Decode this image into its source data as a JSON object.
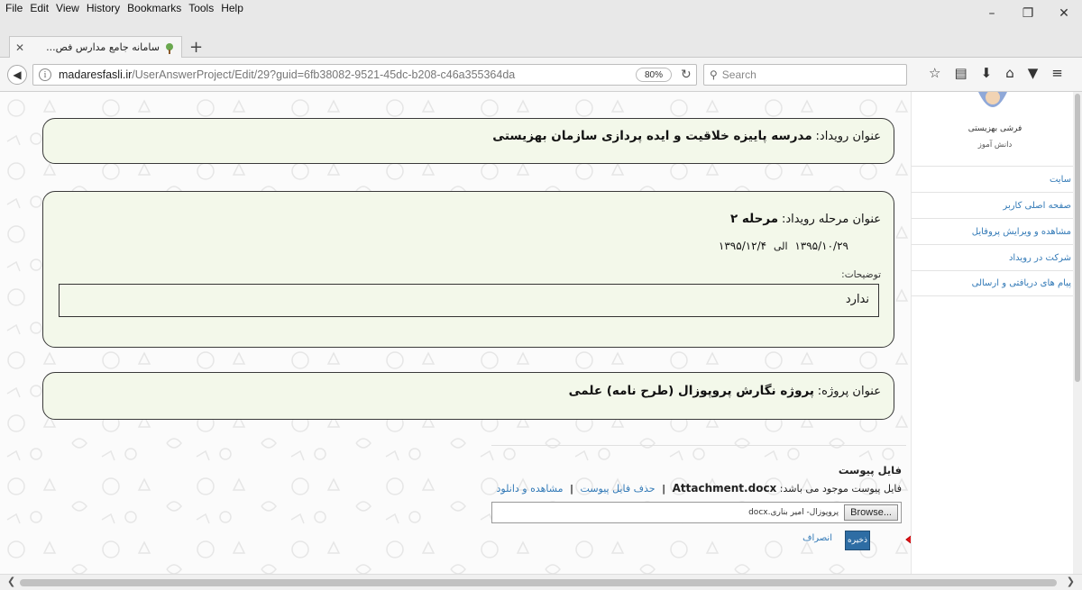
{
  "browser": {
    "menus": [
      "File",
      "Edit",
      "View",
      "History",
      "Bookmarks",
      "Tools",
      "Help"
    ],
    "tab_title": "سامانه جامع مدارس فص...",
    "url_host": "madaresfasli.ir",
    "url_path": "/UserAnswerProject/Edit/29?guid=6fb38082-9521-45dc-b208-c46a355364da",
    "zoom": "80%",
    "search_placeholder": "Search"
  },
  "event": {
    "title_label": "عنوان رویداد:",
    "title_value": "مدرسه پاییزه خلاقیت و ایده پردازی سازمان بهزیستی"
  },
  "stage": {
    "title_label": "عنوان مرحله رویداد:",
    "title_value": "مرحله ۲",
    "date_from": "۱۳۹۵/۱۰/۲۹",
    "date_sep": "الی",
    "date_to": "۱۳۹۵/۱۲/۴",
    "desc_label": "توضیحات:",
    "desc_value": "ندارد"
  },
  "project": {
    "title_label": "عنوان پروژه:",
    "title_value": "پروژه نگارش پروپوزال (طرح نامه) علمی"
  },
  "upload": {
    "title": "فایل پیوست",
    "existing_text": "فایل پیوست موجود می باشد:",
    "existing_file": "Attachment.docx",
    "delete_link": "حذف فایل پیوست",
    "view_link": "مشاهده و دانلود",
    "browse_label": "Browse...",
    "selected_file": "پروپوزال- امیر بناری.docx",
    "save_label": "ذخیره",
    "cancel_label": "انصراف"
  },
  "sidebar": {
    "user_name": "فرشی بهزیستی",
    "user_role": "دانش آموز",
    "items": [
      "سایت",
      "صفحه اصلی کاربر",
      "مشاهده و ویرایش پروفایل",
      "شرکت در رویداد",
      "پیام های دریافتی و ارسالی"
    ]
  },
  "colors": {
    "card_bg": "#f3f8ea",
    "link": "#337ab7",
    "save_button": "#2e6da4",
    "arrow": "#e8141b"
  }
}
